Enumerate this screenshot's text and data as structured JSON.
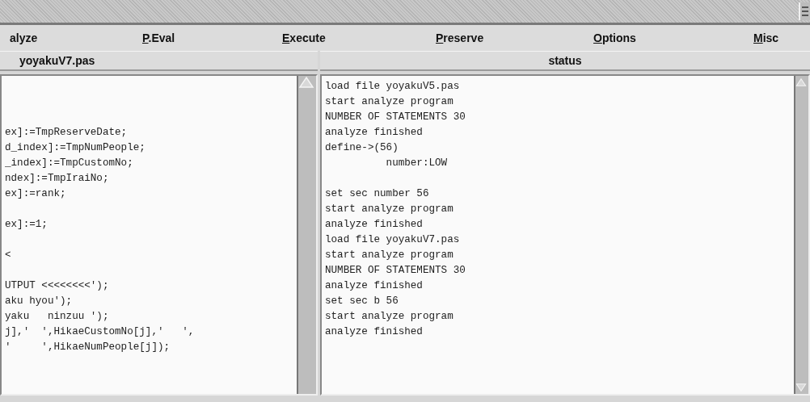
{
  "menu": [
    {
      "rest": "alyze"
    },
    {
      "key": "P",
      "rest": ".Eval"
    },
    {
      "key": "E",
      "rest": "xecute"
    },
    {
      "key": "P",
      "rest": "reserve"
    },
    {
      "key": "O",
      "rest": "ptions"
    },
    {
      "key": "M",
      "rest": "isc"
    }
  ],
  "panels": [
    {
      "title": "yoyakuV7.pas",
      "lines": [
        {
          "kind": "blank"
        },
        {
          "kind": "blank"
        },
        {
          "kind": "blank"
        },
        {
          "kind": "text",
          "text": "ex]:=TmpReserveDate;"
        },
        {
          "kind": "text",
          "text": "d_index]:=TmpNumPeople;"
        },
        {
          "kind": "text",
          "text": "_index]:=TmpCustomNo;"
        },
        {
          "kind": "text",
          "text": "ndex]:=TmpIraiNo;"
        },
        {
          "kind": "text",
          "text": "ex]:=rank;"
        },
        {
          "kind": "blank"
        },
        {
          "kind": "text",
          "text": "ex]:=1;"
        },
        {
          "kind": "blank"
        },
        {
          "kind": "text",
          "text": "<"
        },
        {
          "kind": "blank"
        },
        {
          "kind": "text",
          "text": "UTPUT <<<<<<<<');"
        },
        {
          "kind": "text",
          "text": "aku hyou');"
        },
        {
          "kind": "text",
          "text": "yaku   ninzuu ');"
        },
        {
          "kind": "text",
          "text": "j],'  ',HikaeCustomNo[j],'   ',"
        },
        {
          "kind": "text",
          "text": "'     ',HikaeNumPeople[j]);"
        }
      ]
    },
    {
      "title": "status",
      "lines": [
        {
          "kind": "text",
          "text": "load file yoyakuV5.pas"
        },
        {
          "kind": "text",
          "text": "start analyze program"
        },
        {
          "kind": "text",
          "text": "NUMBER OF STATEMENTS 30"
        },
        {
          "kind": "text",
          "text": "analyze finished"
        },
        {
          "kind": "text",
          "text": "define->(56)"
        },
        {
          "kind": "text",
          "text": "          number:LOW"
        },
        {
          "kind": "blank"
        },
        {
          "kind": "text",
          "text": "set sec number 56"
        },
        {
          "kind": "text",
          "text": "start analyze program"
        },
        {
          "kind": "text",
          "text": "analyze finished"
        },
        {
          "kind": "text",
          "text": "load file yoyakuV7.pas"
        },
        {
          "kind": "text",
          "text": "start analyze program"
        },
        {
          "kind": "text",
          "text": "NUMBER OF STATEMENTS 30"
        },
        {
          "kind": "text",
          "text": "analyze finished"
        },
        {
          "kind": "text",
          "text": "set sec b 56"
        },
        {
          "kind": "text",
          "text": "start analyze program"
        },
        {
          "kind": "text",
          "text": "analyze finished"
        }
      ]
    }
  ]
}
